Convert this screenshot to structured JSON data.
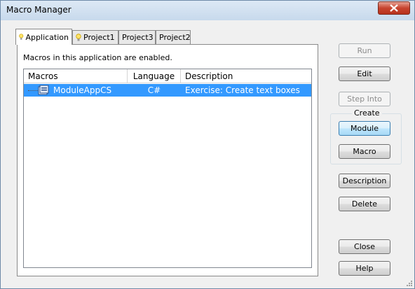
{
  "window": {
    "title": "Macro Manager",
    "close_label": "close"
  },
  "tabs": [
    {
      "label": "Application",
      "active": true
    },
    {
      "label": "Project1",
      "active": false
    },
    {
      "label": "Project3",
      "active": false
    },
    {
      "label": "Project2",
      "active": false
    }
  ],
  "panel": {
    "info_text": "Macros in this application are enabled."
  },
  "list": {
    "columns": [
      "Macros",
      "Language",
      "Description"
    ],
    "rows": [
      {
        "name": "ModuleAppCS",
        "language": "C#",
        "description": "Exercise: Create text boxes",
        "selected": true
      }
    ]
  },
  "buttons": {
    "run": "Run",
    "edit": "Edit",
    "step_into": "Step Into",
    "create_group": "Create",
    "module": "Module",
    "macro": "Macro",
    "description": "Description",
    "delete": "Delete",
    "close": "Close",
    "help": "Help"
  },
  "colors": {
    "selection": "#3399ff",
    "close_button": "#c7442f",
    "accent_default": "#3c7fb1"
  }
}
